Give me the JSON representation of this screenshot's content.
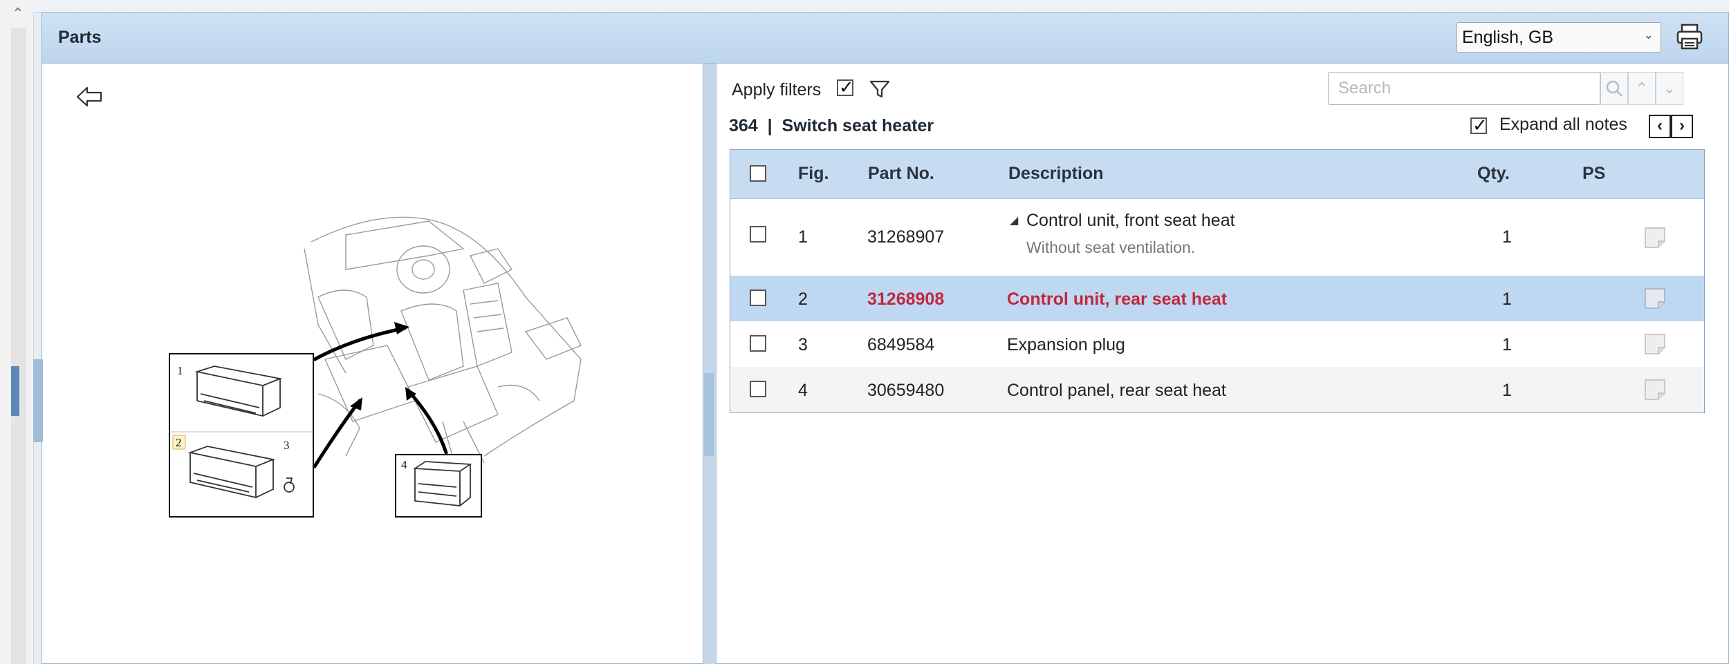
{
  "panel": {
    "title": "Parts"
  },
  "language": {
    "selected": "English, GB"
  },
  "filters": {
    "apply_label": "Apply filters"
  },
  "search": {
    "placeholder": "Search"
  },
  "group": {
    "number": "364",
    "separator": "|",
    "title": "Switch seat heater"
  },
  "notes": {
    "expand_label": "Expand all notes"
  },
  "table": {
    "headers": {
      "fig": "Fig.",
      "part_no": "Part No.",
      "description": "Description",
      "qty": "Qty.",
      "ps": "PS"
    },
    "rows": [
      {
        "fig": "1",
        "part_no": "31268907",
        "description": "Control unit, front seat heat",
        "note": "Without seat ventilation.",
        "qty": "1"
      },
      {
        "fig": "2",
        "part_no": "31268908",
        "description": "Control unit, rear seat heat",
        "qty": "1"
      },
      {
        "fig": "3",
        "part_no": "6849584",
        "description": "Expansion plug",
        "qty": "1"
      },
      {
        "fig": "4",
        "part_no": "30659480",
        "description": "Control panel, rear seat heat",
        "qty": "1"
      }
    ]
  },
  "diagram": {
    "callouts": [
      "1",
      "2",
      "3",
      "4"
    ]
  },
  "icons": {
    "back": "back-arrow-icon",
    "filter": "filter-icon",
    "print": "printer-icon",
    "search": "search-icon",
    "note": "note-icon"
  },
  "colors": {
    "header": "#c7dcf1",
    "selected_row": "#bfd8f1",
    "highlight_text": "#c0283e"
  }
}
